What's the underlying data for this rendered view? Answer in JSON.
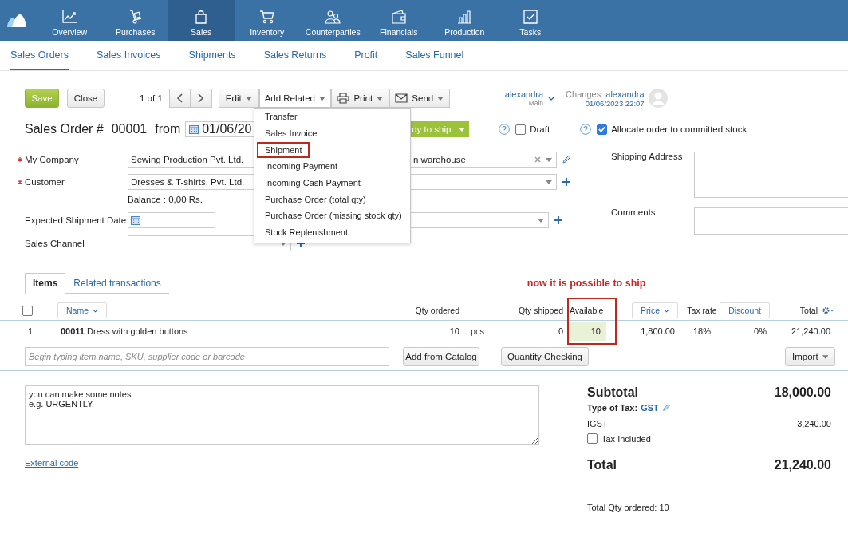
{
  "nav": {
    "items": [
      {
        "label": "Overview",
        "selected": false
      },
      {
        "label": "Purchases",
        "selected": false
      },
      {
        "label": "Sales",
        "selected": true
      },
      {
        "label": "Inventory",
        "selected": false
      },
      {
        "label": "Counterparties",
        "selected": false
      },
      {
        "label": "Financials",
        "selected": false
      },
      {
        "label": "Production",
        "selected": false
      },
      {
        "label": "Tasks",
        "selected": false
      }
    ]
  },
  "subnav": {
    "items": [
      {
        "label": "Sales Orders",
        "selected": true
      },
      {
        "label": "Sales Invoices",
        "selected": false
      },
      {
        "label": "Shipments",
        "selected": false
      },
      {
        "label": "Sales Returns",
        "selected": false
      },
      {
        "label": "Profit",
        "selected": false
      },
      {
        "label": "Sales Funnel",
        "selected": false
      }
    ]
  },
  "toolbar": {
    "save": "Save",
    "close": "Close",
    "pager": "1 of 1",
    "actions": [
      {
        "label": "Edit",
        "kind": "menu",
        "open": false
      },
      {
        "label": "Add Related",
        "kind": "menu",
        "open": true
      },
      {
        "label": "Print",
        "kind": "print",
        "open": false
      },
      {
        "label": "Send",
        "kind": "send",
        "open": false
      }
    ],
    "user": {
      "name": "alexandra",
      "branch": "Main"
    },
    "changes": {
      "label": "Changes:",
      "user": "alexandra",
      "time": "01/06/2023 22:07"
    }
  },
  "add_related_menu": {
    "items": [
      {
        "label": "Transfer",
        "highlighted": false
      },
      {
        "label": "Sales Invoice",
        "highlighted": false
      },
      {
        "label": "Shipment",
        "highlighted": true
      },
      {
        "label": "Incoming Payment",
        "highlighted": false
      },
      {
        "label": "Incoming Cash Payment",
        "highlighted": false
      },
      {
        "label": "Purchase Order (total qty)",
        "highlighted": false
      },
      {
        "label": "Purchase Order (missing stock qty)",
        "highlighted": false
      },
      {
        "label": "Stock Replenishment",
        "highlighted": false
      }
    ]
  },
  "order": {
    "title": "Sales Order #",
    "number": "00001",
    "from": "from",
    "date": "01/06/20",
    "status": "dy to ship",
    "draft": {
      "label": "Draft",
      "checked": false
    },
    "allocate": {
      "label": "Allocate order to committed stock",
      "checked": true
    }
  },
  "form": {
    "my_company": {
      "label": "My Company",
      "value": "Sewing Production Pvt. Ltd.",
      "required": true
    },
    "warehouse": {
      "value": "n warehouse"
    },
    "customer": {
      "label": "Customer",
      "value": "Dresses & T-shirts, Pvt. Ltd.",
      "required": true
    },
    "balance": "Balance : 0,00 Rs.",
    "expected_shipment_date": {
      "label": "Expected Shipment Date",
      "required": false
    },
    "sales_channel": {
      "label": "Sales Channel",
      "required": false
    },
    "shipping_address": {
      "label": "Shipping Address"
    },
    "comments": {
      "label": "Comments"
    }
  },
  "tabs": [
    {
      "label": "Items",
      "selected": true
    },
    {
      "label": "Related transactions",
      "selected": false
    }
  ],
  "annotation": "now it is possible to ship",
  "table": {
    "select_all": {
      "checked": false
    },
    "columns": [
      {
        "label": "Name",
        "kind": "sort"
      },
      {
        "label": "Qty ordered",
        "kind": "plain"
      },
      {
        "label": "Qty shipped",
        "kind": "plain"
      },
      {
        "label": "Available",
        "kind": "plain"
      },
      {
        "label": "Price",
        "kind": "sort"
      },
      {
        "label": "Tax rate",
        "kind": "plain"
      },
      {
        "label": "Discount",
        "kind": "button"
      },
      {
        "label": "Total",
        "kind": "settings"
      }
    ],
    "rows": [
      {
        "index": "1",
        "name": "**00011** Dress with golden buttons",
        "qty_ordered": "10",
        "unit": "pcs",
        "qty_shipped": "0",
        "available": "10",
        "available_ok": true,
        "price": "1,800.00",
        "tax_rate": "18%",
        "discount": "0%",
        "total": "21,240.00"
      }
    ]
  },
  "add_row": {
    "placeholder": "Begin typing item name, SKU, supplier code or barcode",
    "catalog": "Add from Catalog",
    "checking": "Quantity Checking",
    "import": "Import"
  },
  "notes": {
    "value": "you can make some notes\ne.g. URGENTLY"
  },
  "external_code": "External code",
  "summary": {
    "subtotal_label": "Subtotal",
    "subtotal": "18,000.00",
    "tax_type_label": "Type of Tax:",
    "tax_type": "GST",
    "tax_name": "IGST",
    "tax_amount": "3,240.00",
    "tax_included": {
      "label": "Tax Included",
      "checked": false
    },
    "total_label": "Total",
    "total": "21,240.00",
    "total_qty": "Total Qty ordered: 10"
  }
}
